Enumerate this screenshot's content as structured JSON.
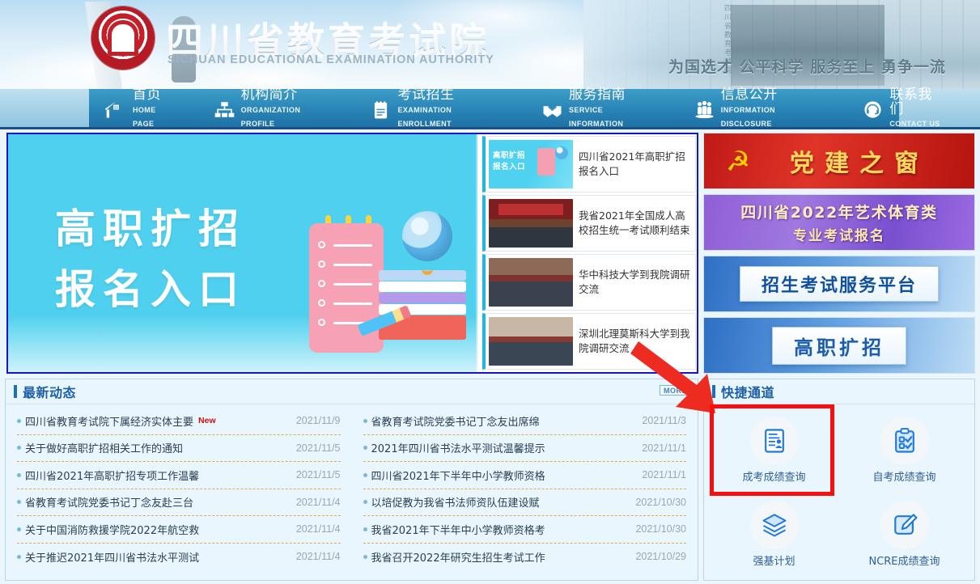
{
  "site": {
    "title_cn": "四川省教育考试院",
    "title_en": "SICHUAN EDUCATIONAL EXAMINATION AUTHORITY",
    "slogan": "为国选才  公平科学  服务至上  勇争一流",
    "building_vertical_text": "四川省教育考试院"
  },
  "nav": {
    "items": [
      {
        "cn": "首页",
        "en": "HOME  PAGE",
        "icon": "home-icon"
      },
      {
        "cn": "机构简介",
        "en": "ORGANIZATION PROFILE",
        "icon": "org-chart-icon"
      },
      {
        "cn": "考试招生",
        "en": "EXAMINATION ENROLLMENT",
        "icon": "calendar-icon"
      },
      {
        "cn": "服务指南",
        "en": "SERVICE  INFORMATION",
        "icon": "handshake-icon"
      },
      {
        "cn": "信息公开",
        "en": "INFORMATION  DISCLOSURE",
        "icon": "people-icon"
      },
      {
        "cn": "联系我们",
        "en": "CONTACT  US",
        "icon": "headset-icon"
      }
    ]
  },
  "hero": {
    "line1": "高职扩招",
    "line2": "报名入口"
  },
  "news_cards": [
    {
      "title": "四川省2021年高职扩招报名入口",
      "thumb": "poster-gaozhi-kuozhao",
      "thumb_text1": "高职扩招",
      "thumb_text2": "报名入口"
    },
    {
      "title": "我省2021年全国成人高校招生统一考试顺利结束",
      "thumb": "photo-meeting-red-backdrop"
    },
    {
      "title": "华中科技大学到我院调研交流",
      "thumb": "photo-conference-room"
    },
    {
      "title": "深圳北理莫斯科大学到我院调研交流",
      "thumb": "photo-conference-room-2"
    }
  ],
  "side_banners": [
    {
      "id": "party-building",
      "text": "党建之窗",
      "emblem": "hammer-sickle-icon"
    },
    {
      "id": "art-sports-exam",
      "line1": "四川省2022年艺术体育类",
      "line2": "专业考试报名"
    },
    {
      "id": "enrollment-service-platform",
      "text": "招生考试服务平台"
    },
    {
      "id": "vocational-expansion",
      "text": "高职扩招"
    }
  ],
  "news_panel": {
    "title": "最新动态",
    "more_label": "MORE",
    "left_items": [
      {
        "title": "四川省教育考试院下属经济实体主要",
        "badge": "New",
        "date": "2021/11/9"
      },
      {
        "title": "关于做好高职扩招相关工作的通知",
        "badge": "",
        "date": "2021/11/5"
      },
      {
        "title": "四川省2021年高职扩招专项工作温馨",
        "badge": "",
        "date": "2021/11/5"
      },
      {
        "title": "省教育考试院党委书记丁念友赴三台",
        "badge": "",
        "date": "2021/11/4"
      },
      {
        "title": "关于中国消防救援学院2022年航空救",
        "badge": "",
        "date": "2021/11/4"
      },
      {
        "title": "关于推迟2021年四川省书法水平测试",
        "badge": "",
        "date": "2021/11/4"
      }
    ],
    "right_items": [
      {
        "title": "省教育考试院党委书记丁念友出席绵",
        "badge": "",
        "date": "2021/11/3"
      },
      {
        "title": "2021年四川省书法水平测试温馨提示",
        "badge": "",
        "date": "2021/11/1"
      },
      {
        "title": "四川省2021年下半年中小学教师资格",
        "badge": "",
        "date": "2021/11/1"
      },
      {
        "title": "以培促教为我省书法师资队伍建设赋",
        "badge": "",
        "date": "2021/10/30"
      },
      {
        "title": "我省2021年下半年中小学教师资格考",
        "badge": "",
        "date": "2021/10/30"
      },
      {
        "title": "我省召开2022年研究生招生考试工作",
        "badge": "",
        "date": "2021/10/29"
      }
    ]
  },
  "quick_panel": {
    "title": "快捷通道",
    "items": [
      {
        "label": "成考成绩查询",
        "icon": "id-document-icon",
        "highlighted": true
      },
      {
        "label": "自考成绩查询",
        "icon": "clipboard-check-icon",
        "highlighted": false
      },
      {
        "label": "强基计划",
        "icon": "layers-icon",
        "highlighted": false
      },
      {
        "label": "NCRE成绩查询",
        "icon": "pencil-square-icon",
        "highlighted": false
      }
    ]
  },
  "annotation": {
    "highlight_color": "#f90d0d",
    "arrow_color": "#ee2b20",
    "target": "成考成绩查询"
  }
}
